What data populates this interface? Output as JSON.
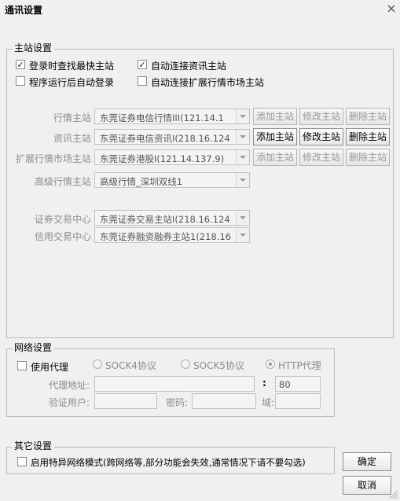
{
  "window": {
    "title": "通讯设置",
    "close_icon": "×"
  },
  "main_station": {
    "legend": "主站设置",
    "checkboxes": [
      {
        "label": "登录时查找最快主站",
        "checked": true
      },
      {
        "label": "自动连接资讯主站",
        "checked": true
      },
      {
        "label": "程序运行后自动登录",
        "checked": false
      },
      {
        "label": "自动连接扩展行情市场主站",
        "checked": false
      }
    ],
    "rows": [
      {
        "label": "行情主站",
        "value": "东莞证券电信行情III(121.14.1",
        "buttons": [
          "添加主站",
          "修改主站",
          "删除主站"
        ]
      },
      {
        "label": "资讯主站",
        "value": "东莞证券电信资讯I(218.16.124",
        "buttons": [
          "添加主站",
          "修改主站",
          "删除主站"
        ]
      },
      {
        "label": "扩展行情市场主站",
        "value": "东莞证券港股I(121.14.137.9)",
        "buttons": [
          "添加主站",
          "修改主站",
          "删除主站"
        ]
      },
      {
        "label": "高级行情主站",
        "value": "高级行情_深圳双线1"
      }
    ],
    "trade_rows": [
      {
        "label": "证券交易中心",
        "value": "东莞证券交易主站I(218.16.124"
      },
      {
        "label": "信用交易中心",
        "value": "东莞证券融资融券主站1(218.16"
      }
    ]
  },
  "network": {
    "legend": "网络设置",
    "use_proxy": {
      "label": "使用代理",
      "checked": false
    },
    "protocols": [
      {
        "label": "SOCK4协议",
        "selected": false
      },
      {
        "label": "SOCK5协议",
        "selected": false
      },
      {
        "label": "HTTP代理",
        "selected": true
      }
    ],
    "proxy_address_label": "代理地址:",
    "proxy_address": "",
    "port_sep": ":",
    "port": "80",
    "auth_user_label": "验证用户:",
    "auth_user": "",
    "password_label": "密码:",
    "password": "",
    "domain_label": "域:",
    "domain": ""
  },
  "other": {
    "legend": "其它设置",
    "special_network": {
      "label": "启用特异网络模式(跨网络等,部分功能会失效,通常情况下请不要勾选)",
      "checked": false
    }
  },
  "actions": {
    "ok": "确定",
    "cancel": "取消"
  }
}
